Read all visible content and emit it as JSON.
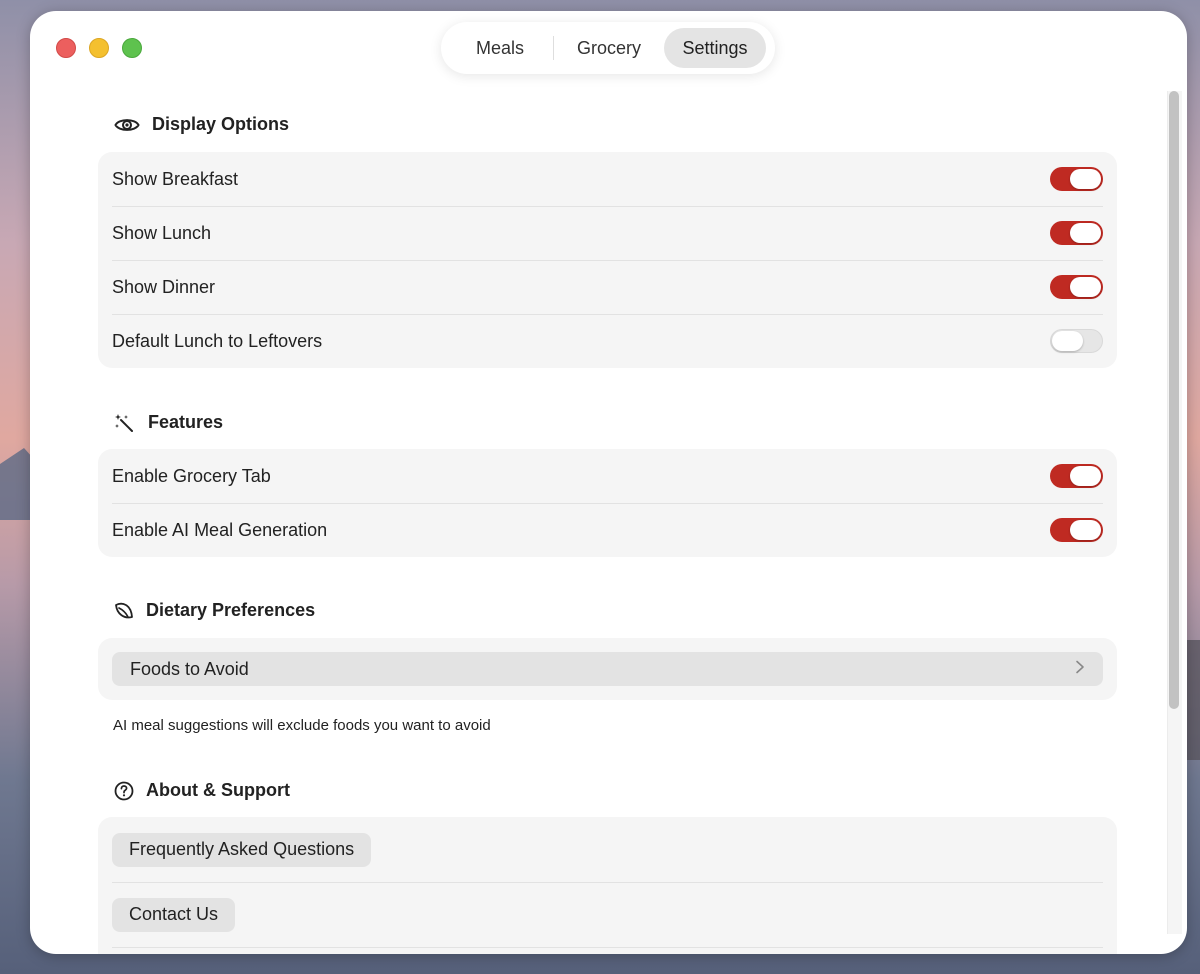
{
  "tabs": {
    "meals": "Meals",
    "grocery": "Grocery",
    "settings": "Settings",
    "selected": "Settings"
  },
  "display_options": {
    "title": "Display Options",
    "icon": "eye-icon",
    "items": [
      {
        "label": "Show Breakfast",
        "enabled": true
      },
      {
        "label": "Show Lunch",
        "enabled": true
      },
      {
        "label": "Show Dinner",
        "enabled": true
      },
      {
        "label": "Default Lunch to Leftovers",
        "enabled": false
      }
    ]
  },
  "features": {
    "title": "Features",
    "icon": "magic-wand-icon",
    "items": [
      {
        "label": "Enable Grocery Tab",
        "enabled": true
      },
      {
        "label": "Enable AI Meal Generation",
        "enabled": true
      }
    ]
  },
  "dietary": {
    "title": "Dietary Preferences",
    "icon": "leaf-icon",
    "foods_to_avoid": "Foods to Avoid",
    "chevron": "chevron-right-icon",
    "footnote": "AI meal suggestions will exclude foods you want to avoid"
  },
  "about": {
    "title": "About & Support",
    "icon": "question-circle-icon",
    "faq": "Frequently Asked Questions",
    "contact": "Contact Us"
  },
  "colors": {
    "toggle_on": "#bf2a22",
    "toggle_off": "#e6e6e6",
    "card_bg": "#f5f5f5"
  }
}
